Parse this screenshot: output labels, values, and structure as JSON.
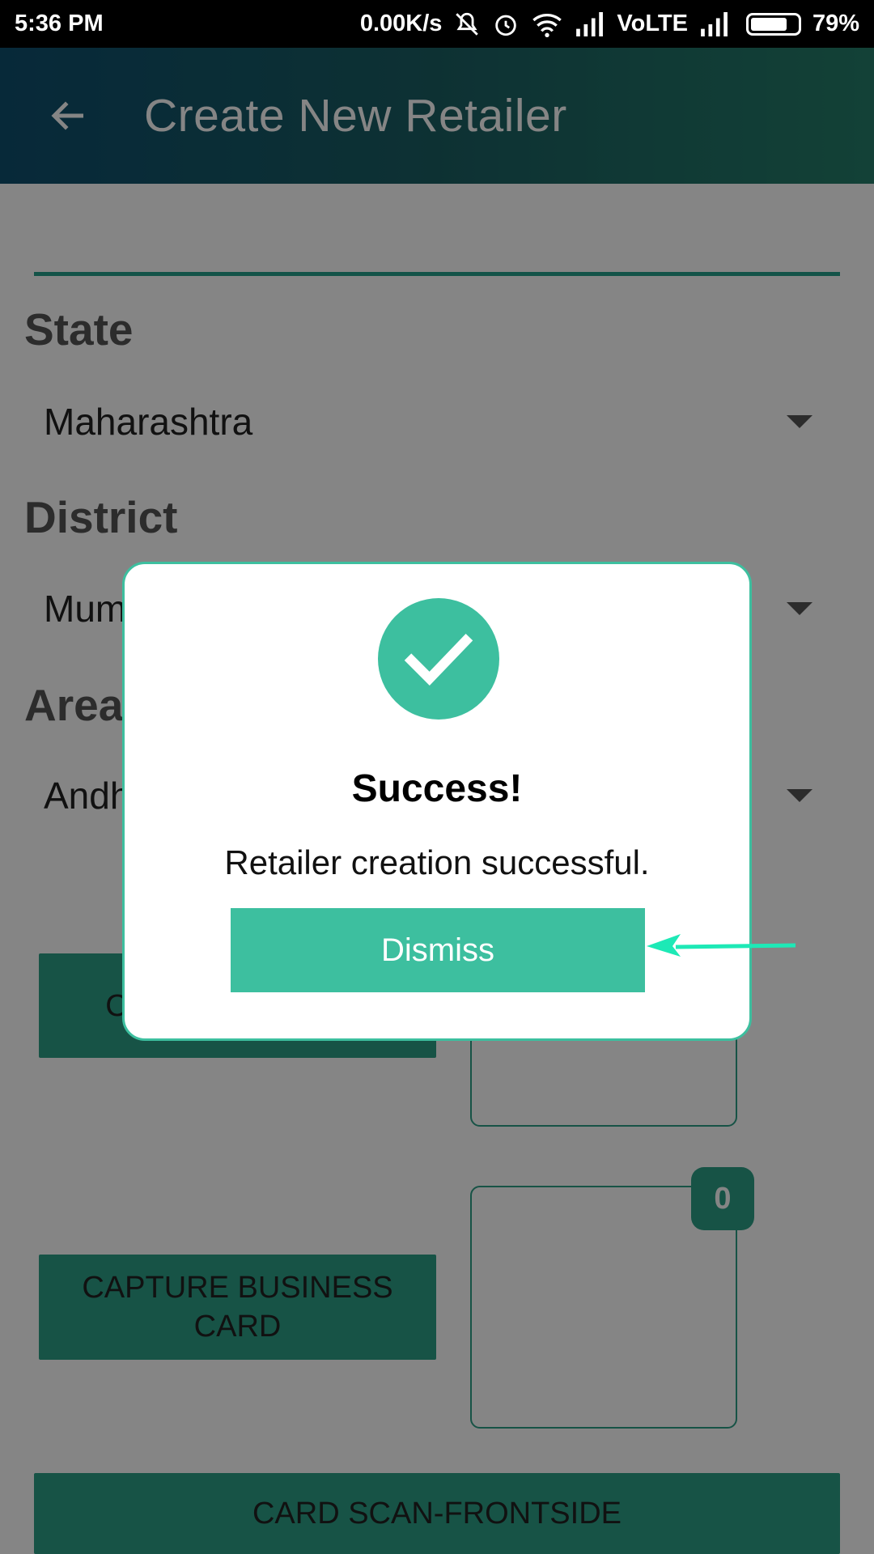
{
  "status_bar": {
    "time": "5:36 PM",
    "net_speed": "0.00K/s",
    "network": "VoLTE",
    "battery": "79%",
    "battery_level": 0.79,
    "icons": [
      "mute-icon",
      "alarm-icon",
      "wifi-icon",
      "signal-icon",
      "signal-icon",
      "battery-icon"
    ]
  },
  "app_bar": {
    "title": "Create New Retailer",
    "back_icon": "arrow-left-icon"
  },
  "form": {
    "state_label": "State",
    "state_value": "Maharashtra",
    "district_label": "District",
    "district_value": "Mumbai",
    "area_label": "Area",
    "area_value": "Andheri",
    "capture_photo_label": "CAPTURE PHOTO",
    "capture_business_card_label": "CAPTURE BUSINESS CARD",
    "business_card_count": "0",
    "card_scan_label": "CARD SCAN-FRONTSIDE"
  },
  "colors": {
    "accent": "#3dbf9f",
    "button_green": "#2c9f86",
    "arrow": "#1de9b6"
  },
  "dialog": {
    "icon": "check-circle-icon",
    "title": "Success!",
    "message": "Retailer creation successful.",
    "dismiss_label": "Dismiss"
  }
}
